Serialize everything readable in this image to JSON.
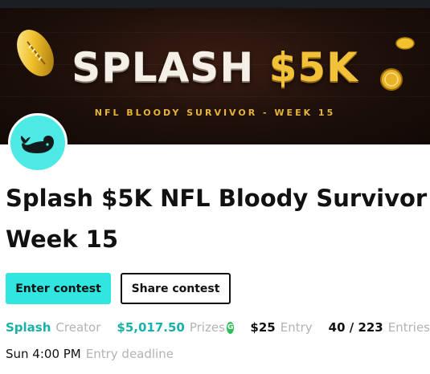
{
  "banner": {
    "title_part1": "SPLASH ",
    "title_part2": "$5K",
    "subtitle": "NFL BLOODY SURVIVOR - WEEK 15"
  },
  "contest": {
    "title": "Splash $5K NFL Bloody Survivor Week 15"
  },
  "actions": {
    "enter_label": "Enter contest",
    "share_label": "Share contest"
  },
  "stats": {
    "creator_name": "Splash",
    "creator_label": "Creator",
    "prizes_value": "$5,017.50",
    "prizes_label": "Prizes",
    "prizes_badge": "G",
    "entry_value": "$25",
    "entry_label": "Entry",
    "entries_value": "40 / 223",
    "entries_label": "Entries",
    "deadline_value": "Sun 4:00 PM",
    "deadline_label": "Entry deadline"
  },
  "colors": {
    "accent": "#31e6e1",
    "creator_text": "#1ab1a8",
    "banner_gold": "#f2c13a",
    "badge_green": "#2fbf5a"
  },
  "icons": {
    "avatar": "whale-icon",
    "banner_ball": "football-icon",
    "banner_coins": "coin-icon"
  }
}
